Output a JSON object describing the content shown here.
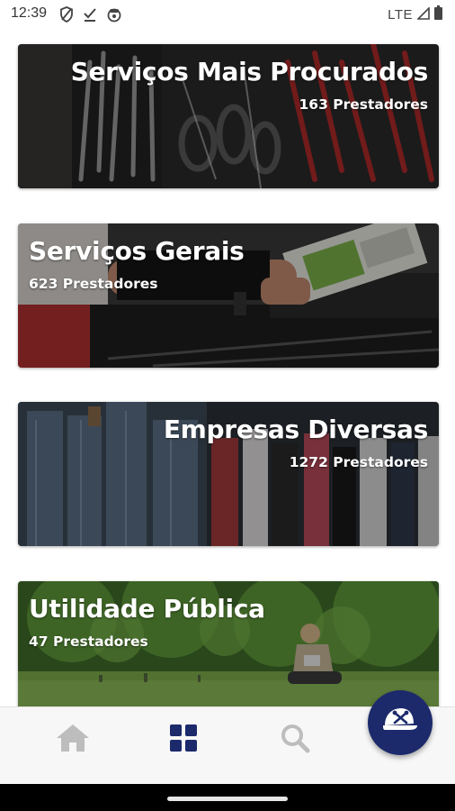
{
  "status_bar": {
    "time": "12:39",
    "network": "LTE",
    "icons_left": [
      "shield-icon",
      "download-done-icon",
      "cloud-sync-icon"
    ],
    "icons_right": [
      "signal-icon",
      "battery-icon"
    ]
  },
  "categories": [
    {
      "title": "Serviços Mais Procurados",
      "count": "163 Prestadores",
      "align": "right",
      "theme": "tools"
    },
    {
      "title": "Serviços Gerais",
      "count": "623 Prestadores",
      "align": "left",
      "theme": "car-engine"
    },
    {
      "title": "Empresas Diversas",
      "count": "1272 Prestadores",
      "align": "right",
      "theme": "clothes-rack"
    },
    {
      "title": "Utilidade Pública",
      "count": "47 Prestadores",
      "align": "left",
      "theme": "park"
    }
  ],
  "bottom_nav": {
    "items": [
      {
        "icon": "home-icon",
        "active": false
      },
      {
        "icon": "grid-icon",
        "active": true
      },
      {
        "icon": "search-icon",
        "active": false
      }
    ],
    "fab_icon": "worker-cap-tools-icon"
  },
  "colors": {
    "accent": "#1c2a6b",
    "nav_inactive": "#bdbdbd",
    "nav_background": "#f7f7f7"
  }
}
